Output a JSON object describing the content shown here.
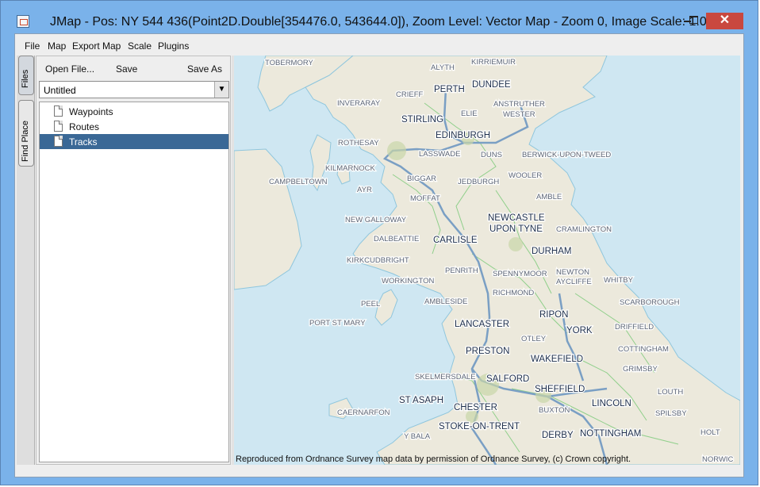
{
  "window": {
    "title": "JMap - Pos: NY 544 436(Point2D.Double[354476.0, 543644.0]), Zoom Level: Vector Map - Zoom 0, Image Scale: 1.0",
    "close_glyph": "✕"
  },
  "menu": {
    "items": [
      {
        "label": "File"
      },
      {
        "label": "Map"
      },
      {
        "label": "Export Map"
      },
      {
        "label": "Scale"
      },
      {
        "label": "Plugins"
      }
    ]
  },
  "side_tabs": {
    "files": "Files",
    "find_place": "Find Place"
  },
  "files_panel": {
    "open_label": "Open File...",
    "save_label": "Save",
    "save_as_label": "Save As",
    "dropdown_value": "Untitled",
    "tree": [
      {
        "label": "Waypoints",
        "selected": false
      },
      {
        "label": "Routes",
        "selected": false
      },
      {
        "label": "Tracks",
        "selected": true
      }
    ]
  },
  "map": {
    "copyright": "Reproduced from Ordnance Survey map data by permission of Ordnance Survey, (c) Crown copyright.",
    "sea_color": "#cfe7f2",
    "land_color": "#ece9dc",
    "water_line_color": "#8fc6dd",
    "road_color": "#7a9fc4",
    "minor_road_color": "#8fcf8a",
    "places": [
      {
        "name": "TOBERMORY",
        "major": false
      },
      {
        "name": "ALYTH",
        "major": false
      },
      {
        "name": "KIRRIEMUIR",
        "major": false
      },
      {
        "name": "PERTH",
        "major": true
      },
      {
        "name": "DUNDEE",
        "major": true
      },
      {
        "name": "INVERARAY",
        "major": false
      },
      {
        "name": "CRIEFF",
        "major": false
      },
      {
        "name": "ANSTRUTHER",
        "major": false
      },
      {
        "name": "WESTER",
        "major": false
      },
      {
        "name": "STIRLING",
        "major": true
      },
      {
        "name": "ELIE",
        "major": false
      },
      {
        "name": "EDINBURGH",
        "major": true
      },
      {
        "name": "ROTHESAY",
        "major": false
      },
      {
        "name": "LASSWADE",
        "major": false
      },
      {
        "name": "DUNS",
        "major": false
      },
      {
        "name": "BERWICK-UPON-TWEED",
        "major": false
      },
      {
        "name": "KILMARNOCK",
        "major": false
      },
      {
        "name": "BIGGAR",
        "major": false
      },
      {
        "name": "WOOLER",
        "major": false
      },
      {
        "name": "CAMPBELTOWN",
        "major": false
      },
      {
        "name": "AYR",
        "major": false
      },
      {
        "name": "JEDBURGH",
        "major": false
      },
      {
        "name": "MOFFAT",
        "major": false
      },
      {
        "name": "AMBLE",
        "major": false
      },
      {
        "name": "NEW GALLOWAY",
        "major": false
      },
      {
        "name": "NEWCASTLE",
        "major": true
      },
      {
        "name": "UPON TYNE",
        "major": true
      },
      {
        "name": "CRAMLINGTON",
        "major": false
      },
      {
        "name": "DALBEATTIE",
        "major": false
      },
      {
        "name": "CARLISLE",
        "major": true
      },
      {
        "name": "DURHAM",
        "major": true
      },
      {
        "name": "KIRKCUDBRIGHT",
        "major": false
      },
      {
        "name": "PENRITH",
        "major": false
      },
      {
        "name": "SPENNYMOOR",
        "major": false
      },
      {
        "name": "NEWTON",
        "major": false
      },
      {
        "name": "AYCLIFFE",
        "major": false
      },
      {
        "name": "WORKINGTON",
        "major": false
      },
      {
        "name": "WHITBY",
        "major": false
      },
      {
        "name": "RICHMOND",
        "major": false
      },
      {
        "name": "PEEL",
        "major": false
      },
      {
        "name": "AMBLESIDE",
        "major": false
      },
      {
        "name": "SCARBOROUGH",
        "major": false
      },
      {
        "name": "RIPON",
        "major": true
      },
      {
        "name": "PORT ST MARY",
        "major": false
      },
      {
        "name": "LANCASTER",
        "major": true
      },
      {
        "name": "YORK",
        "major": true
      },
      {
        "name": "DRIFFIELD",
        "major": false
      },
      {
        "name": "OTLEY",
        "major": false
      },
      {
        "name": "PRESTON",
        "major": true
      },
      {
        "name": "COTTINGHAM",
        "major": false
      },
      {
        "name": "WAKEFIELD",
        "major": true
      },
      {
        "name": "GRIMSBY",
        "major": false
      },
      {
        "name": "SKELMERSDALE",
        "major": false
      },
      {
        "name": "SALFORD",
        "major": true
      },
      {
        "name": "SHEFFIELD",
        "major": true
      },
      {
        "name": "LOUTH",
        "major": false
      },
      {
        "name": "ST ASAPH",
        "major": true
      },
      {
        "name": "LINCOLN",
        "major": true
      },
      {
        "name": "CAERNARFON",
        "major": false
      },
      {
        "name": "CHESTER",
        "major": true
      },
      {
        "name": "BUXTON",
        "major": false
      },
      {
        "name": "SPILSBY",
        "major": false
      },
      {
        "name": "STOKE-ON-TRENT",
        "major": true
      },
      {
        "name": "Y BALA",
        "major": false
      },
      {
        "name": "DERBY",
        "major": true
      },
      {
        "name": "NOTTINGHAM",
        "major": true
      },
      {
        "name": "HOLT",
        "major": false
      },
      {
        "name": "NORWIC",
        "major": false
      }
    ]
  }
}
